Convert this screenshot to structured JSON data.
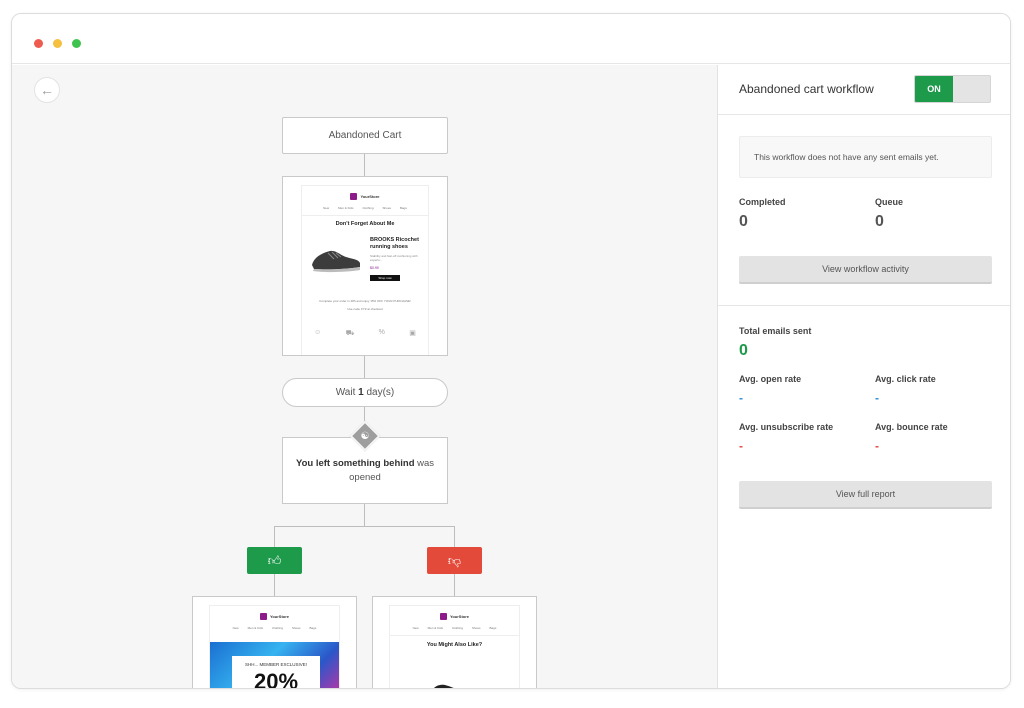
{
  "window": {
    "traffic_lights": [
      "#ee5b4f",
      "#f5bf3f",
      "#3fc34f"
    ]
  },
  "canvas": {
    "back_icon": "arrow-left-icon",
    "trigger_title": "Abandoned Cart",
    "email_preview": {
      "store_name": "YourStore",
      "nav": [
        "New",
        "Men & Kids",
        "Clothing",
        "Shoes",
        "Bags"
      ],
      "heading": "Don't Forget About Me",
      "product_name": "BROOKS Ricochet running shoes",
      "product_desc": "Stability and fast-off cushioning with experts...",
      "price": "$0.99",
      "cta": "Shop now",
      "footer_line1": "Complete your order in 48h and enjoy 15% OFF YOUR PURCHASE!",
      "footer_line2": "Use code XYZ at checkout"
    },
    "wait_prefix": "Wait ",
    "wait_value": "1",
    "wait_suffix": " day(s)",
    "condition_bold": "You left something behind",
    "condition_rest": " was opened",
    "yes_icon": "thumbs-up-icon",
    "no_icon": "thumbs-down-icon",
    "yes_card": {
      "store_name": "YourStore",
      "nav": [
        "New",
        "Men & Kids",
        "Clothing",
        "Shoes",
        "Bags"
      ],
      "banner_text": "SHH... MEMBER EXCLUSIVE!",
      "big_text": "20%"
    },
    "no_card": {
      "store_name": "YourStore",
      "nav": [
        "New",
        "Men & Kids",
        "Clothing",
        "Shoes",
        "Bags"
      ],
      "heading": "You Might Also Like?"
    }
  },
  "panel": {
    "title": "Abandoned cart workflow",
    "toggle_label": "ON",
    "notice": "This workflow does not have any sent emails yet.",
    "completed_label": "Completed",
    "completed_value": "0",
    "queue_label": "Queue",
    "queue_value": "0",
    "activity_button": "View workflow activity",
    "total_sent_label": "Total emails sent",
    "total_sent_value": "0",
    "open_rate_label": "Avg. open rate",
    "open_rate_value": "-",
    "click_rate_label": "Avg. click rate",
    "click_rate_value": "-",
    "unsub_rate_label": "Avg. unsubscribe rate",
    "unsub_rate_value": "-",
    "bounce_rate_label": "Avg. bounce rate",
    "bounce_rate_value": "-",
    "report_button": "View full report",
    "colors": {
      "accent_green": "#1e9a4b",
      "accent_red": "#e34a3a",
      "accent_blue": "#2d8fd5"
    }
  }
}
